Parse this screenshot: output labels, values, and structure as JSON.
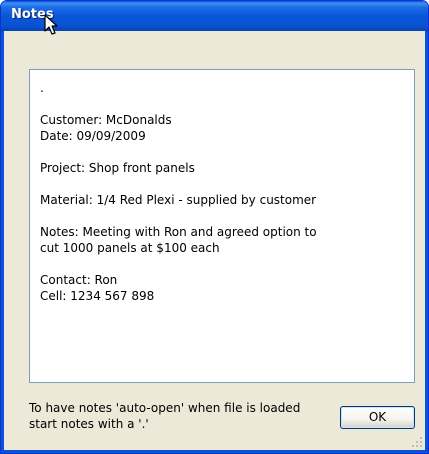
{
  "window": {
    "title": "Notes"
  },
  "notes": {
    "text": ".\n\nCustomer: McDonalds\nDate: 09/09/2009\n\nProject: Shop front panels\n\nMaterial: 1/4 Red Plexi - supplied by customer\n\nNotes: Meeting with Ron and agreed option to\ncut 1000 panels at $100 each\n\nContact: Ron\nCell: 1234 567 898"
  },
  "footer": {
    "hint": "To have notes 'auto-open' when file is loaded start notes with a '.'",
    "ok_label": "OK"
  },
  "icons": {
    "cursor": "mouse-pointer-icon",
    "grip": "resize-grip-icon"
  },
  "colors": {
    "titlebar": "#0a54d4",
    "dialog_bg": "#ece9d8",
    "title_text": "#ffffff"
  }
}
